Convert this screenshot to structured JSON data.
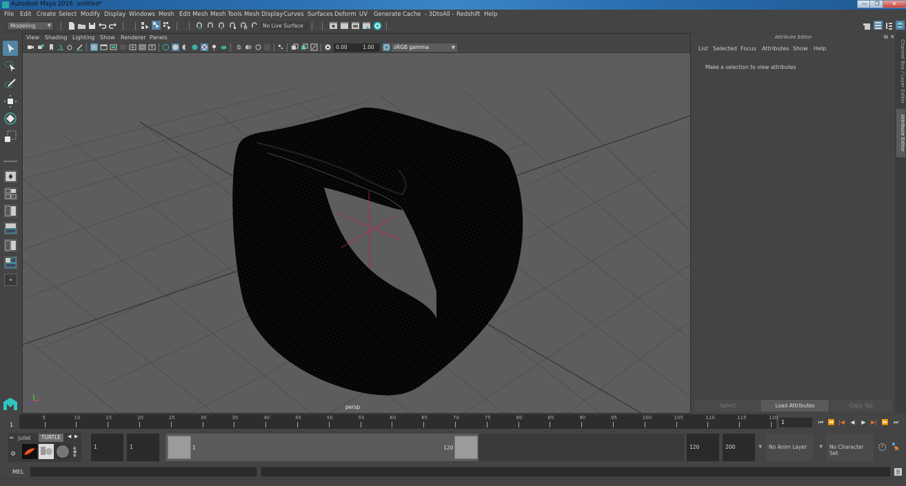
{
  "window": {
    "title": "Autodesk Maya 2016: untitled*",
    "minimize_label": "—",
    "restore_label": "❐",
    "close_label": "✕"
  },
  "menubar": {
    "items": [
      "File",
      "Edit",
      "Create",
      "Select",
      "Modify",
      "Display",
      "Windows",
      "Mesh",
      "Edit Mesh",
      "Mesh Tools",
      "Mesh Display",
      "Curves",
      "Surfaces",
      "Deform",
      "UV",
      "Generate",
      "Cache",
      "- 3DtoAll -",
      "Redshift",
      "Help"
    ]
  },
  "statusline": {
    "mode": "Modeling",
    "live_surface": "No Live Surface"
  },
  "viewport": {
    "menu": [
      "View",
      "Shading",
      "Lighting",
      "Show",
      "Renderer",
      "Panels"
    ],
    "exposure": "0.00",
    "gamma": "1.00",
    "color_space": "sRGB gamma",
    "camera_label": "persp",
    "accent_color": "#5285a6"
  },
  "attribute_editor": {
    "title": "Attribute Editor",
    "menu": [
      "List",
      "Selected",
      "Focus",
      "Attributes",
      "Show",
      "Help"
    ],
    "hint": "Make a selection to view attributes",
    "buttons": {
      "select": "Select",
      "load": "Load Attributes",
      "copy": "Copy Tab"
    }
  },
  "side_tabs": {
    "channel_box": "Channel Box / Layer Editor",
    "attribute_editor": "Attribute Editor"
  },
  "timeline": {
    "current_frame": "1",
    "ticks": [
      "5",
      "10",
      "15",
      "20",
      "25",
      "30",
      "35",
      "40",
      "45",
      "50",
      "55",
      "60",
      "65",
      "70",
      "75",
      "80",
      "85",
      "90",
      "95",
      "100",
      "105",
      "110",
      "115",
      "120"
    ],
    "current_frame_field": "1",
    "playback": [
      "⏮",
      "⏪",
      "|◀",
      "◀",
      "▶",
      "▶|",
      "⏩",
      "⏭"
    ]
  },
  "range": {
    "shelf_tabs": [
      "Jullet",
      "TURTLE"
    ],
    "start_time": "1",
    "playback_start": "1",
    "range_start_label": "1",
    "range_end_label": "120",
    "playback_end": "120",
    "end_time": "200",
    "anim_layer": "No Anim Layer",
    "character_set": "No Character Set"
  },
  "command_line": {
    "label": "MEL"
  }
}
